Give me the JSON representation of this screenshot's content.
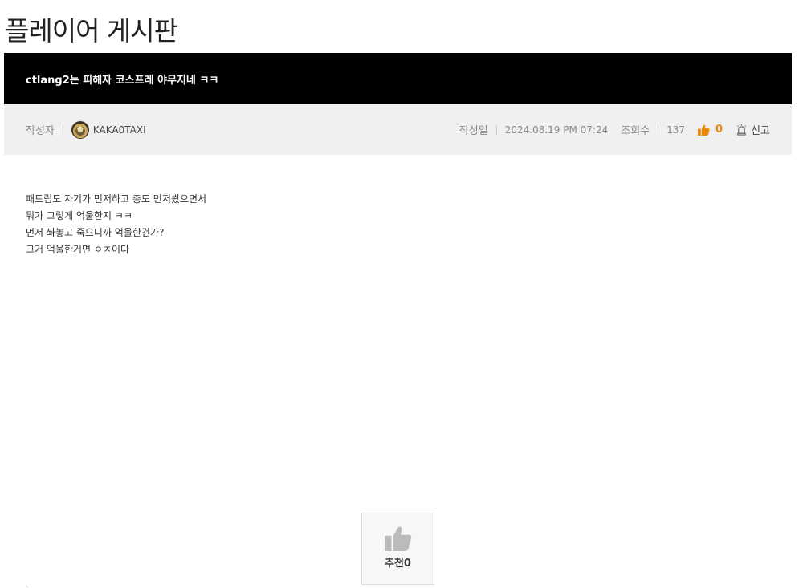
{
  "board": {
    "title": "플레이어 게시판"
  },
  "post": {
    "title": "ctlang2는 피해자 코스프레 야무지네 ㅋㅋ",
    "author_label": "작성자",
    "author_name": "KAKA0TAXI",
    "date_label": "작성일",
    "date": "2024.08.19 PM 07:24",
    "views_label": "조회수",
    "views": "137",
    "likes": "0",
    "report_label": "신고",
    "body": [
      "패드립도 자기가 먼저하고 총도 먼저쐈으면서",
      "뭐가 그렇게 억울한지 ㅋㅋ",
      "먼저 쏴놓고 죽으니까 억울한건가?",
      "그거 억울한거면 ㅇㅈ이다"
    ]
  },
  "recommend": {
    "label": "추천0"
  },
  "colors": {
    "accent": "#e8890c",
    "title_bar": "#000000",
    "meta_bg": "#f0f0f0"
  },
  "icons": [
    "thumbs-up-icon",
    "bell-icon",
    "avatar"
  ]
}
